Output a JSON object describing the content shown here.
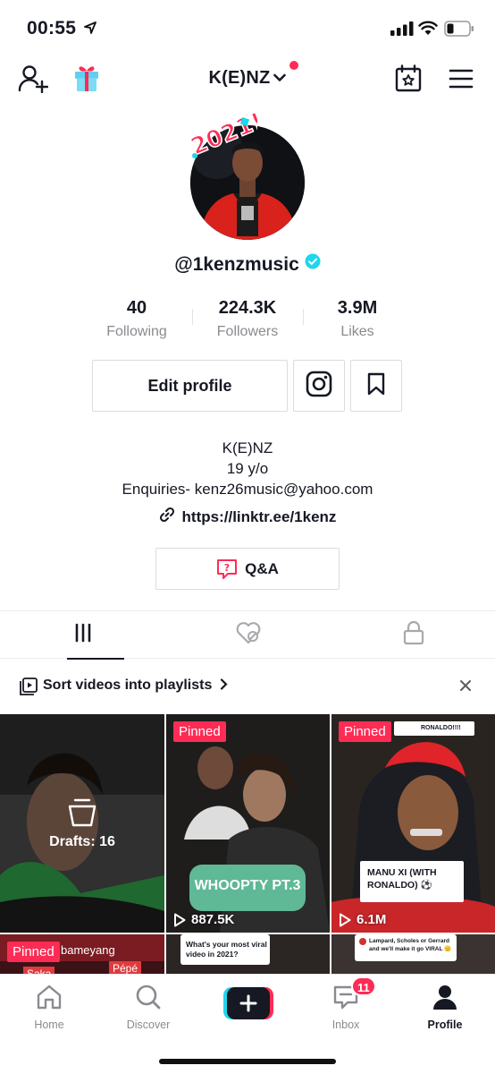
{
  "status_bar": {
    "time": "00:55"
  },
  "top_nav": {
    "title": "K(E)NZ"
  },
  "profile": {
    "handle": "@1kenzmusic",
    "avatar_badge": "2021!",
    "stats": [
      {
        "value": "40",
        "label": "Following"
      },
      {
        "value": "224.3K",
        "label": "Followers"
      },
      {
        "value": "3.9M",
        "label": "Likes"
      }
    ],
    "edit_profile_label": "Edit profile",
    "bio_lines": [
      "K(E)NZ",
      "19 y/o",
      "Enquiries- kenz26music@yahoo.com"
    ],
    "link": "https://linktr.ee/1kenz",
    "qa_label": "Q&A"
  },
  "playlist_banner": {
    "text": "Sort videos into playlists"
  },
  "videos": [
    {
      "drafts_label": "Drafts: 16"
    },
    {
      "pinned_label": "Pinned",
      "caption": "WHOOPTY PT.3",
      "views": "887.5K"
    },
    {
      "pinned_label": "Pinned",
      "caption": "MANU XI (WITH RONALDO) ⚽",
      "views": "6.1M",
      "top_note": "RONALDO!!!!"
    },
    {
      "pinned_label": "Pinned",
      "caption": "bameyang",
      "sub": "Saka",
      "sub2": "Pépé"
    },
    {
      "caption": "What's your most viral video in 2021?"
    },
    {
      "caption": "Lampard, Scholes or Gerrard and we'll make it go VIRAL 🫡"
    }
  ],
  "bottom_nav": {
    "home": "Home",
    "discover": "Discover",
    "inbox": "Inbox",
    "inbox_badge": "11",
    "profile": "Profile"
  },
  "colors": {
    "accent": "#fe2c55",
    "verified": "#20d5ec",
    "text": "#161823",
    "muted": "#8a8b91"
  }
}
